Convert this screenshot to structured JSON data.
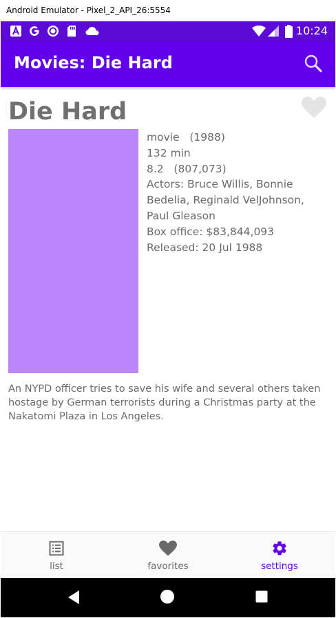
{
  "window": {
    "title": "Android Emulator - Pixel_2_API_26:5554"
  },
  "status_bar": {
    "time": "10:24",
    "background": "#5e0ad6",
    "left_icons": [
      "a-notification-icon",
      "google-icon",
      "circle-notification-icon",
      "sd-card-icon",
      "cloud-icon"
    ],
    "right_icons": [
      "wifi-icon",
      "cell-signal-icon",
      "battery-icon"
    ]
  },
  "app_bar": {
    "title": "Movies: Die Hard",
    "background": "#6200ee",
    "action_icon": "search-icon"
  },
  "movie": {
    "title": "Die Hard",
    "favorite_icon": "heart-icon",
    "poster_color": "#bb86fc",
    "type_line": "movie   (1988)",
    "runtime": "132 min",
    "rating_line": "8.2   (807,073)",
    "actors": "Actors: Bruce Willis, Bonnie Bedelia, Reginald VelJohnson, Paul Gleason",
    "box_office": "Box office: $83,844,093",
    "released": "Released: 20 Jul 1988",
    "description": "An NYPD officer tries to save his wife and several others taken hostage by German terrorists during a Christmas party at the Nakatomi Plaza in Los Angeles."
  },
  "bottom_nav": {
    "items": [
      {
        "label": "list",
        "icon": "list-icon",
        "active": false
      },
      {
        "label": "favorites",
        "icon": "heart-icon",
        "active": false
      },
      {
        "label": "settings",
        "icon": "gear-icon",
        "active": true
      }
    ],
    "active_color": "#6200ee"
  },
  "system_nav": {
    "buttons": [
      "back-icon",
      "home-icon",
      "recents-icon"
    ]
  }
}
